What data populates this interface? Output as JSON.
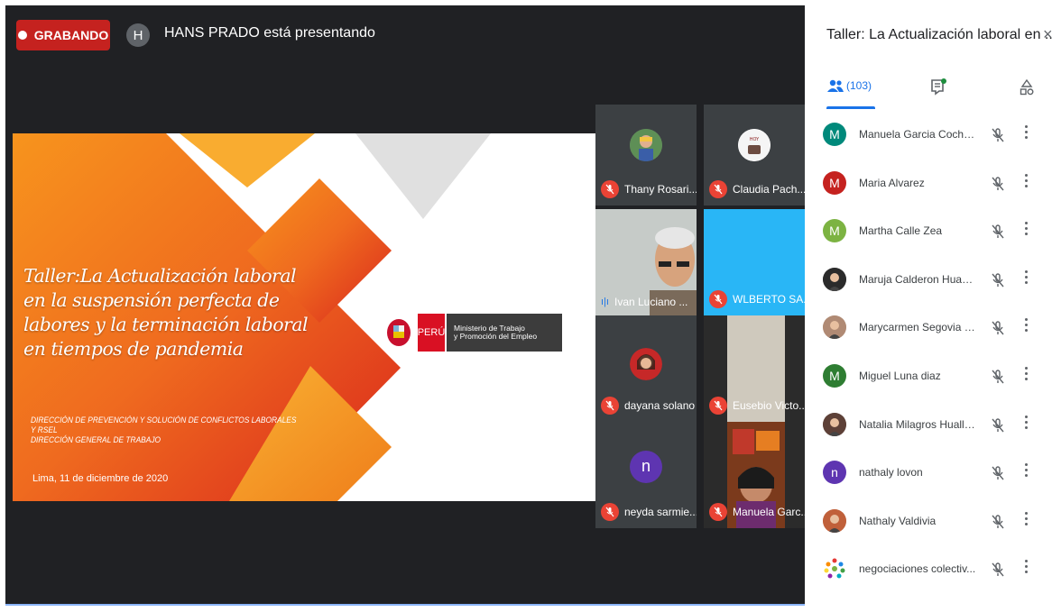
{
  "recording": {
    "label": "GRABANDO"
  },
  "presenter": {
    "initial": "H",
    "text": "HANS PRADO está presentando"
  },
  "slide": {
    "title_lines": [
      "Taller:La Actualización laboral",
      "en la suspensión perfecta de",
      "labores y la terminación laboral",
      "en tiempos de pandemia"
    ],
    "dept_lines": [
      "DIRECCIÓN DE PREVENCIÓN Y SOLUCIÓN DE CONFLICTOS LABORALES",
      "Y RSEL",
      "DIRECCIÓN GENERAL DE TRABAJO"
    ],
    "date": "Lima, 11 de diciembre de 2020",
    "logo_peru": "PERÚ",
    "logo_ministry_1": "Ministerio de Trabajo",
    "logo_ministry_2": "y Promoción del Empleo"
  },
  "tiles": [
    {
      "name": "Thany Rosari..."
    },
    {
      "name": "Claudia Pach..."
    },
    {
      "name": "Ivan Luciano ..."
    },
    {
      "name": "WLBERTO SA..."
    },
    {
      "name": "dayana solano"
    },
    {
      "name": "Eusebio Victo..."
    },
    {
      "name": "neyda sarmie...",
      "initial": "n"
    },
    {
      "name": "Manuela Garc..."
    }
  ],
  "sidebar": {
    "title": "Taller: La Actualización laboral en ...",
    "people_count": "(103)",
    "participants": [
      {
        "name": "Manuela Garcia Cochag...",
        "initial": "M",
        "color": "#00897b"
      },
      {
        "name": "Maria Alvarez",
        "initial": "M",
        "color": "#c5221f"
      },
      {
        "name": "Martha Calle Zea",
        "initial": "M",
        "color": "#7cb342"
      },
      {
        "name": "Maruja Calderon Huam...",
        "initial": "",
        "color": "#2b2b2b"
      },
      {
        "name": "Marycarmen Segovia Ll...",
        "initial": "",
        "color": "#b08a74"
      },
      {
        "name": "Miguel Luna diaz",
        "initial": "M",
        "color": "#2e7d32"
      },
      {
        "name": "Natalia Milagros Huallan...",
        "initial": "",
        "color": "#5d4037"
      },
      {
        "name": "nathaly lovon",
        "initial": "n",
        "color": "#5e35b1"
      },
      {
        "name": "Nathaly Valdivia",
        "initial": "",
        "color": "#c0603a"
      },
      {
        "name": "negociaciones colectiv...",
        "initial": "",
        "color": "#ffffff"
      }
    ]
  }
}
